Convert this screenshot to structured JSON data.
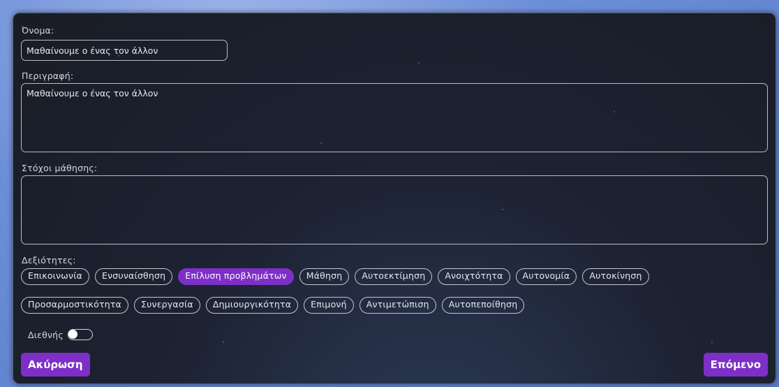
{
  "form": {
    "name_label": "Όνομα:",
    "name_value": "Μαθαίνουμε ο ένας τον άλλον",
    "description_label": "Περιγραφή:",
    "description_value": "Μαθαίνουμε ο ένας τον άλλον",
    "objectives_label": "Στόχοι μάθησης:",
    "objectives_value": "",
    "skills_label": "Δεξιότητες:",
    "skills_row1": [
      {
        "label": "Επικοινωνία",
        "selected": false
      },
      {
        "label": "Ενσυναίσθηση",
        "selected": false
      },
      {
        "label": "Επίλυση προβλημάτων",
        "selected": true
      },
      {
        "label": "Μάθηση",
        "selected": false
      },
      {
        "label": "Αυτοεκτίμηση",
        "selected": false
      },
      {
        "label": "Ανοιχτότητα",
        "selected": false
      },
      {
        "label": "Αυτονομία",
        "selected": false
      },
      {
        "label": "Αυτοκίνηση",
        "selected": false
      }
    ],
    "skills_row2": [
      {
        "label": "Προσαρμοστικότητα",
        "selected": false
      },
      {
        "label": "Συνεργασία",
        "selected": false
      },
      {
        "label": "Δημιουργικότητα",
        "selected": false
      },
      {
        "label": "Επιμονή",
        "selected": false
      },
      {
        "label": "Αντιμετώπιση",
        "selected": false
      },
      {
        "label": "Αυτοπεποίθηση",
        "selected": false
      }
    ],
    "international_label": "Διεθνής",
    "international_on": false
  },
  "footer": {
    "cancel_label": "Ακύρωση",
    "next_label": "Επόμενο"
  },
  "colors": {
    "accent": "#7d2fc7",
    "panel_bg": "#1d2333",
    "page_bg": "#6d8fd8"
  }
}
